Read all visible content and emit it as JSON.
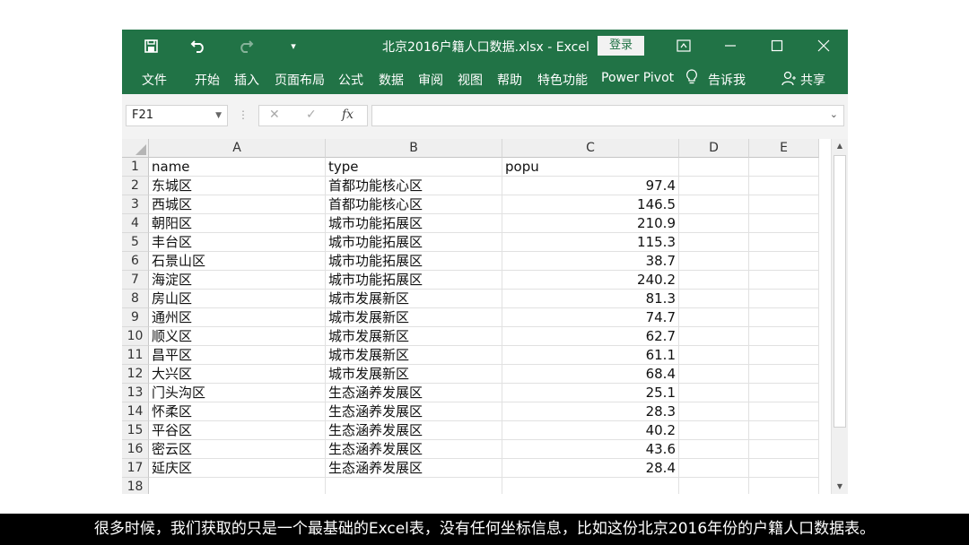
{
  "window": {
    "title": "北京2016户籍人口数据.xlsx  -  Excel",
    "signin_label": "登录"
  },
  "ribbon": {
    "tabs": [
      "文件",
      "开始",
      "插入",
      "页面布局",
      "公式",
      "数据",
      "审阅",
      "视图",
      "帮助",
      "特色功能",
      "Power Pivot"
    ],
    "tell_me": "告诉我",
    "share": "共享"
  },
  "formula_bar": {
    "name_box": "F21",
    "cancel_glyph": "✕",
    "enter_glyph": "✓",
    "fx_label": "fx",
    "value": ""
  },
  "sheet": {
    "columns": [
      "A",
      "B",
      "C",
      "D",
      "E"
    ],
    "row_numbers": [
      "1",
      "2",
      "3",
      "4",
      "5",
      "6",
      "7",
      "8",
      "9",
      "10",
      "11",
      "12",
      "13",
      "14",
      "15",
      "16",
      "17",
      "18"
    ],
    "header": [
      "name",
      "type",
      "popu"
    ],
    "rows": [
      [
        "东城区",
        "首都功能核心区",
        "97.4"
      ],
      [
        "西城区",
        "首都功能核心区",
        "146.5"
      ],
      [
        "朝阳区",
        "城市功能拓展区",
        "210.9"
      ],
      [
        "丰台区",
        "城市功能拓展区",
        "115.3"
      ],
      [
        "石景山区",
        "城市功能拓展区",
        "38.7"
      ],
      [
        "海淀区",
        "城市功能拓展区",
        "240.2"
      ],
      [
        "房山区",
        "城市发展新区",
        "81.3"
      ],
      [
        "通州区",
        "城市发展新区",
        "74.7"
      ],
      [
        "顺义区",
        "城市发展新区",
        "62.7"
      ],
      [
        "昌平区",
        "城市发展新区",
        "61.1"
      ],
      [
        "大兴区",
        "城市发展新区",
        "68.4"
      ],
      [
        "门头沟区",
        "生态涵养发展区",
        "25.1"
      ],
      [
        "怀柔区",
        "生态涵养发展区",
        "28.3"
      ],
      [
        "平谷区",
        "生态涵养发展区",
        "40.2"
      ],
      [
        "密云区",
        "生态涵养发展区",
        "43.6"
      ],
      [
        "延庆区",
        "生态涵养发展区",
        "28.4"
      ]
    ]
  },
  "caption": "很多时候，我们获取的只是一个最基础的Excel表，没有任何坐标信息，比如这份北京2016年份的户籍人口数据表。",
  "colors": {
    "excel_green": "#217346",
    "caption_bg": "#000000",
    "grid_header": "#efefef"
  },
  "icons": {
    "qat": [
      "save-icon",
      "undo-icon",
      "redo-icon",
      "customize-qat-icon"
    ],
    "window": [
      "ribbon-display-icon",
      "minimize-icon",
      "maximize-icon",
      "close-icon"
    ],
    "ribbon": [
      "lightbulb-icon",
      "person-share-icon"
    ]
  }
}
